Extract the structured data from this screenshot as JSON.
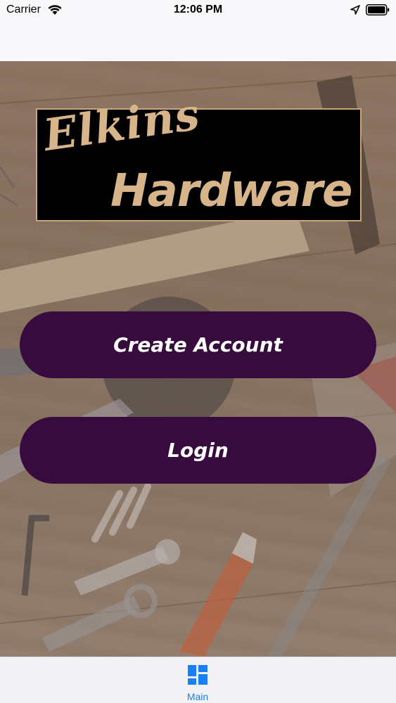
{
  "status_bar": {
    "carrier": "Carrier",
    "time": "12:06 PM",
    "icons": [
      "wifi-icon",
      "location-arrow-icon",
      "battery-icon"
    ]
  },
  "logo": {
    "script_text": "Elkins",
    "bold_text": "Hardware",
    "text_color": "#d7b48a",
    "background_color": "#000000"
  },
  "buttons": {
    "create_account": "Create Account",
    "login": "Login",
    "color": "#380b3f"
  },
  "tab_bar": {
    "items": [
      {
        "label": "Main",
        "icon": "grid-icon",
        "selected": true
      }
    ],
    "accent_color": "#1a7ef5"
  }
}
